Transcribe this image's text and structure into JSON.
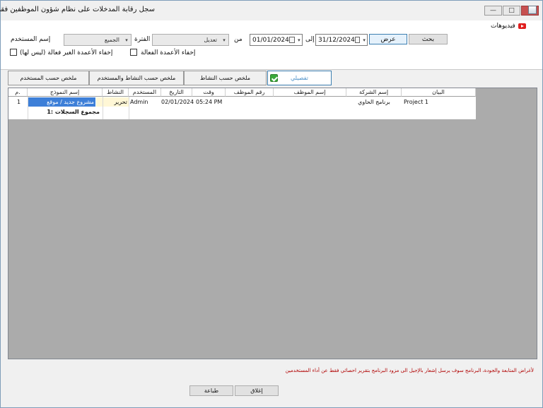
{
  "window": {
    "title": "سجل رقابة المدخلات على نظام شؤون الموظفين فقط",
    "controls": [
      "minimize-icon",
      "maximize-icon",
      "close-icon"
    ]
  },
  "toolbar": {
    "videos_label": "فيديوهات",
    "user_label": "إسم المستخدم",
    "user_value": "الجميع",
    "period_label": "الفترة",
    "period_value": "تعديل",
    "from_label": "من",
    "from_date": "01/01/2024",
    "to_label": "إلى",
    "to_date": "31/12/2024",
    "view_button": "عرض",
    "search_button": "بحث",
    "hide_active_label": "إخفاء الأعمدة الفعالة",
    "hide_inactive_label": "إخفاء الأعمدة الغير فعالة (ليس لها)"
  },
  "tabs": [
    {
      "label": "تفصيلي",
      "active": true
    },
    {
      "label": "ملخص حسب النشاط"
    },
    {
      "label": "ملخص حسب النشاط والمستخدم"
    },
    {
      "label": "ملخص حسب المستخدم"
    }
  ],
  "grid": {
    "headers": {
      "no": "م.",
      "form": "إسم النموذج",
      "activity": "النشاط",
      "user": "المستخدم",
      "date": "التاريخ",
      "time": "وقت",
      "emp_no": "رقم الموظف",
      "emp_name": "إسم الموظف",
      "company": "إسم الشركة",
      "statement": "البيان"
    },
    "rows": [
      {
        "no": "1",
        "form": "مشروع جديد / موقع",
        "activity": "تحرير",
        "user": "Admin",
        "date": "02/01/2024",
        "time": "05:24 PM",
        "emp_no": "",
        "emp_name": "",
        "company": "برنامج الحاوي",
        "statement": "Project 1"
      }
    ],
    "footer": "مجموع السجلات :1"
  },
  "footer": {
    "note": "لأغراض المتابعة والجودة، البرنامج سوف يرسل إشعار بالإجيل الى مزود البرنامج بتقرير احصائي فقط عن أداء المستخدمين",
    "print_button": "طباعة",
    "close_button": "إغلاق"
  },
  "colors": {
    "accent": "#3c7fb1",
    "selection": "#3d7fd8",
    "note_red": "#b00000",
    "youtube_red": "#e01e1e"
  }
}
